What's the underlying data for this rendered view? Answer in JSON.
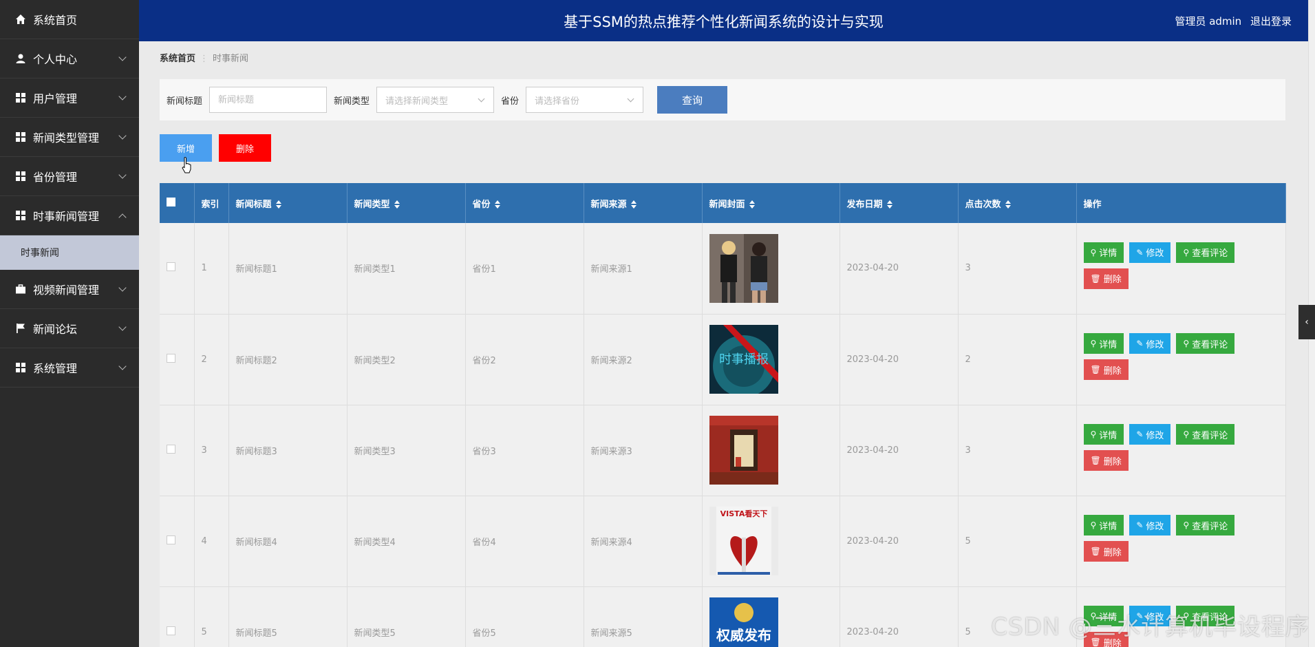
{
  "header": {
    "title": "基于SSM的热点推荐个性化新闻系统的设计与实现",
    "user_label": "管理员 admin",
    "logout": "退出登录"
  },
  "sidebar": {
    "items": [
      {
        "label": "系统首页",
        "icon": "home-icon"
      },
      {
        "label": "个人中心",
        "icon": "user-icon"
      },
      {
        "label": "用户管理",
        "icon": "grid-icon"
      },
      {
        "label": "新闻类型管理",
        "icon": "grid-icon"
      },
      {
        "label": "省份管理",
        "icon": "grid-icon"
      },
      {
        "label": "时事新闻管理",
        "icon": "grid-icon"
      },
      {
        "label": "视频新闻管理",
        "icon": "briefcase-icon"
      },
      {
        "label": "新闻论坛",
        "icon": "flag-icon"
      },
      {
        "label": "系统管理",
        "icon": "grid-icon"
      }
    ],
    "sub_active": "时事新闻"
  },
  "breadcrumb": {
    "home": "系统首页",
    "current": "时事新闻"
  },
  "search": {
    "title_label": "新闻标题",
    "title_placeholder": "新闻标题",
    "type_label": "新闻类型",
    "type_placeholder": "请选择新闻类型",
    "province_label": "省份",
    "province_placeholder": "请选择省份",
    "query": "查询"
  },
  "actions": {
    "add": "新增",
    "delete": "删除"
  },
  "table": {
    "columns": [
      "索引",
      "新闻标题",
      "新闻类型",
      "省份",
      "新闻来源",
      "新闻封面",
      "发布日期",
      "点击次数",
      "操作"
    ],
    "rows": [
      {
        "index": "1",
        "title": "新闻标题1",
        "type": "新闻类型1",
        "province": "省份1",
        "source": "新闻来源1",
        "date": "2023-04-20",
        "clicks": "3"
      },
      {
        "index": "2",
        "title": "新闻标题2",
        "type": "新闻类型2",
        "province": "省份2",
        "source": "新闻来源2",
        "date": "2023-04-20",
        "clicks": "2"
      },
      {
        "index": "3",
        "title": "新闻标题3",
        "type": "新闻类型3",
        "province": "省份3",
        "source": "新闻来源3",
        "date": "2023-04-20",
        "clicks": "3"
      },
      {
        "index": "4",
        "title": "新闻标题4",
        "type": "新闻类型4",
        "province": "省份4",
        "source": "新闻来源4",
        "date": "2023-04-20",
        "clicks": "5"
      },
      {
        "index": "5",
        "title": "新闻标题5",
        "type": "新闻类型5",
        "province": "省份5",
        "source": "新闻来源5",
        "date": "2023-04-20",
        "clicks": "5"
      }
    ],
    "ops": {
      "detail": "详情",
      "edit": "修改",
      "comment": "查看评论",
      "remove": "删除"
    },
    "cover_text": {
      "r2": "时事播报",
      "r4": "VISTA看天下",
      "r5": "权威发布"
    }
  },
  "watermark": "CSDN @三水计算机毕设程序"
}
